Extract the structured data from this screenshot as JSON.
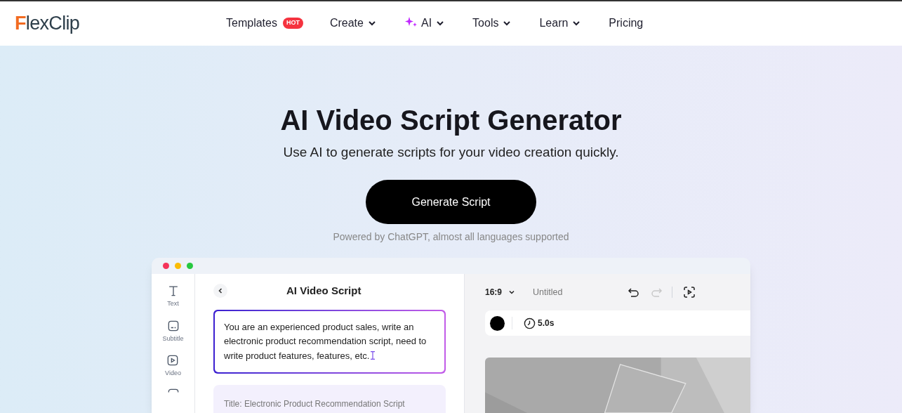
{
  "header": {
    "logo": "FlexClip",
    "nav": [
      {
        "label": "Templates",
        "badge": "HOT",
        "dropdown": false,
        "ai": false
      },
      {
        "label": "Create",
        "dropdown": true,
        "ai": false
      },
      {
        "label": "AI",
        "dropdown": true,
        "ai": true
      },
      {
        "label": "Tools",
        "dropdown": true,
        "ai": false
      },
      {
        "label": "Learn",
        "dropdown": true,
        "ai": false
      },
      {
        "label": "Pricing",
        "dropdown": false,
        "ai": false
      }
    ]
  },
  "hero": {
    "title": "AI Video Script Generator",
    "subtitle": "Use AI to generate scripts for your video creation quickly.",
    "button": "Generate Script",
    "note": "Powered by ChatGPT, almost all languages supported"
  },
  "editor": {
    "sidebar": [
      {
        "kind": "text",
        "label": "Text"
      },
      {
        "kind": "subtitle",
        "label": "Subtitle"
      },
      {
        "kind": "video",
        "label": "Video"
      },
      {
        "kind": "more"
      }
    ],
    "panel": {
      "title": "AI Video Script",
      "prompt": "You are an experienced product sales, write an electronic product recommendation script, need to write product features, features, etc.",
      "result": "Title: Electronic Product Recommendation Script"
    },
    "toolbar": {
      "ratio": "16:9",
      "project": "Untitled",
      "redo_disabled": true
    },
    "clip": {
      "color": "#000000",
      "duration": "5.0s"
    }
  }
}
